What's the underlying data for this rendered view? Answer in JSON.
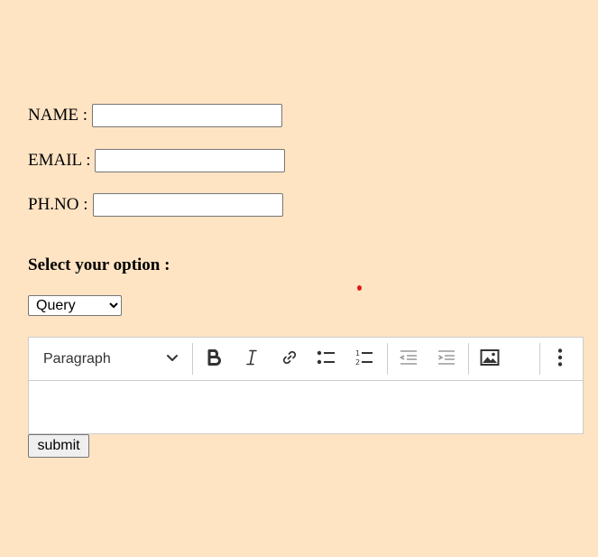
{
  "form": {
    "name_label": "NAME :",
    "name_value": "",
    "email_label": "EMAIL :",
    "email_value": "",
    "phone_label": "PH.NO :",
    "phone_value": ""
  },
  "option": {
    "heading": "Select your option :",
    "selected": "Query"
  },
  "editor": {
    "block_style": "Paragraph",
    "tools": [
      "bold-icon",
      "italic-icon",
      "link-icon",
      "bulleted-list-icon",
      "numbered-list-icon",
      "outdent-icon",
      "indent-icon",
      "image-icon",
      "more-options-icon"
    ]
  },
  "submit_label": "submit"
}
